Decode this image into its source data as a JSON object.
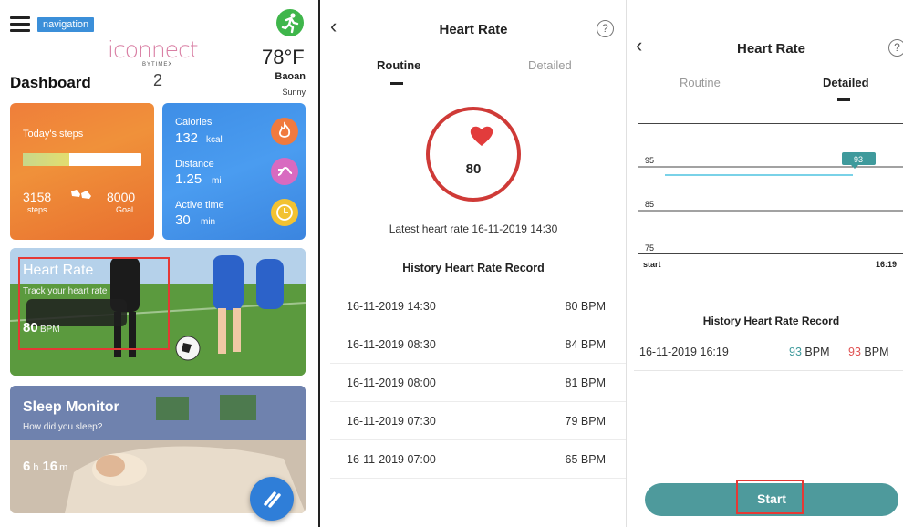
{
  "dashboard": {
    "nav_tag": "navigation",
    "logo_text": "iconnect",
    "logo_sub": "BYTIMEX",
    "logo_num": "2",
    "title": "Dashboard",
    "weather": {
      "temp": "78°F",
      "city": "Baoan",
      "condition": "Sunny"
    },
    "steps_card": {
      "label": "Today's steps",
      "steps": "3158",
      "steps_unit": "steps",
      "goal": "8000",
      "goal_unit": "Goal",
      "progress": 0.39
    },
    "stats_card": {
      "calories_label": "Calories",
      "calories_value": "132",
      "calories_unit": "kcal",
      "distance_label": "Distance",
      "distance_value": "1.25",
      "distance_unit": "mi",
      "active_label": "Active time",
      "active_value": "30",
      "active_unit": "min"
    },
    "heart_card": {
      "title": "Heart Rate",
      "subtitle": "Track your heart rate",
      "value": "80",
      "unit": "BPM"
    },
    "sleep_card": {
      "title": "Sleep Monitor",
      "subtitle": "How did you sleep?",
      "hours": "6",
      "h_unit": "h",
      "minutes": "16",
      "m_unit": "m"
    },
    "colors": {
      "steps": "#ef7e3a",
      "stats": "#3e8ee6",
      "fab": "#2f7ed8",
      "highlight": "#e53935"
    },
    "icons": [
      "menu-icon",
      "runner-icon",
      "shoe-icon",
      "flame-icon",
      "route-icon",
      "clock-icon",
      "fab-icon"
    ]
  },
  "routine": {
    "title": "Heart Rate",
    "help": "?",
    "tabs": [
      {
        "label": "Routine",
        "active": true
      },
      {
        "label": "Detailed",
        "active": false
      }
    ],
    "current_bpm": "80",
    "latest": "Latest heart rate  16-11-2019 14:30",
    "history_title": "History Heart Rate Record",
    "records": [
      {
        "date": "16-11-2019 14:30",
        "bpm": "80 BPM"
      },
      {
        "date": "16-11-2019 08:30",
        "bpm": "84 BPM"
      },
      {
        "date": "16-11-2019 08:00",
        "bpm": "81 BPM"
      },
      {
        "date": "16-11-2019 07:30",
        "bpm": "79 BPM"
      },
      {
        "date": "16-11-2019 07:00",
        "bpm": "65 BPM"
      }
    ]
  },
  "detailed": {
    "title": "Heart Rate",
    "help": "?",
    "tabs": [
      {
        "label": "Routine",
        "active": false
      },
      {
        "label": "Detailed",
        "active": true
      }
    ],
    "chart": {
      "y_labels": [
        "95",
        "85",
        "75"
      ],
      "x_start": "start",
      "x_end": "16:19",
      "tooltip": "93",
      "line_value": 93
    },
    "history_title": "History Heart Rate Record",
    "record": {
      "date": "16-11-2019 16:19",
      "bpm1": "93",
      "bpm1_unit": "BPM",
      "bpm2": "93",
      "bpm2_unit": "BPM"
    },
    "start_label": "Start",
    "colors": {
      "line": "#4fc3e0",
      "tooltip": "#3f9a9c",
      "bpm1": "#3f9a9c",
      "bpm2": "#e05252",
      "button": "#4e9a9c"
    }
  }
}
